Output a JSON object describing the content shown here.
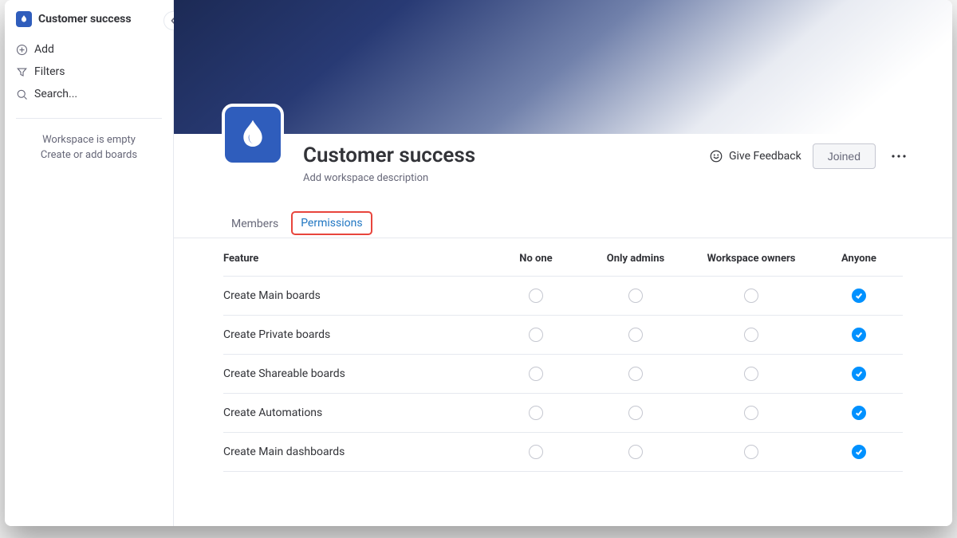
{
  "sidebar": {
    "title": "Customer success",
    "actions": {
      "add": "Add",
      "filters": "Filters",
      "search": "Search..."
    },
    "empty_line1": "Workspace is empty",
    "empty_line2": "Create or add boards"
  },
  "workspace": {
    "title": "Customer success",
    "description_placeholder": "Add workspace description"
  },
  "header_actions": {
    "feedback": "Give Feedback",
    "joined": "Joined"
  },
  "tabs": {
    "members": "Members",
    "permissions": "Permissions"
  },
  "permissions": {
    "columns": {
      "feature": "Feature",
      "no_one": "No one",
      "only_admins": "Only admins",
      "workspace_owners": "Workspace owners",
      "anyone": "Anyone"
    },
    "rows": [
      {
        "label": "Create Main boards",
        "selected": "anyone"
      },
      {
        "label": "Create Private boards",
        "selected": "anyone"
      },
      {
        "label": "Create Shareable boards",
        "selected": "anyone"
      },
      {
        "label": "Create Automations",
        "selected": "anyone"
      },
      {
        "label": "Create Main dashboards",
        "selected": "anyone"
      }
    ]
  }
}
